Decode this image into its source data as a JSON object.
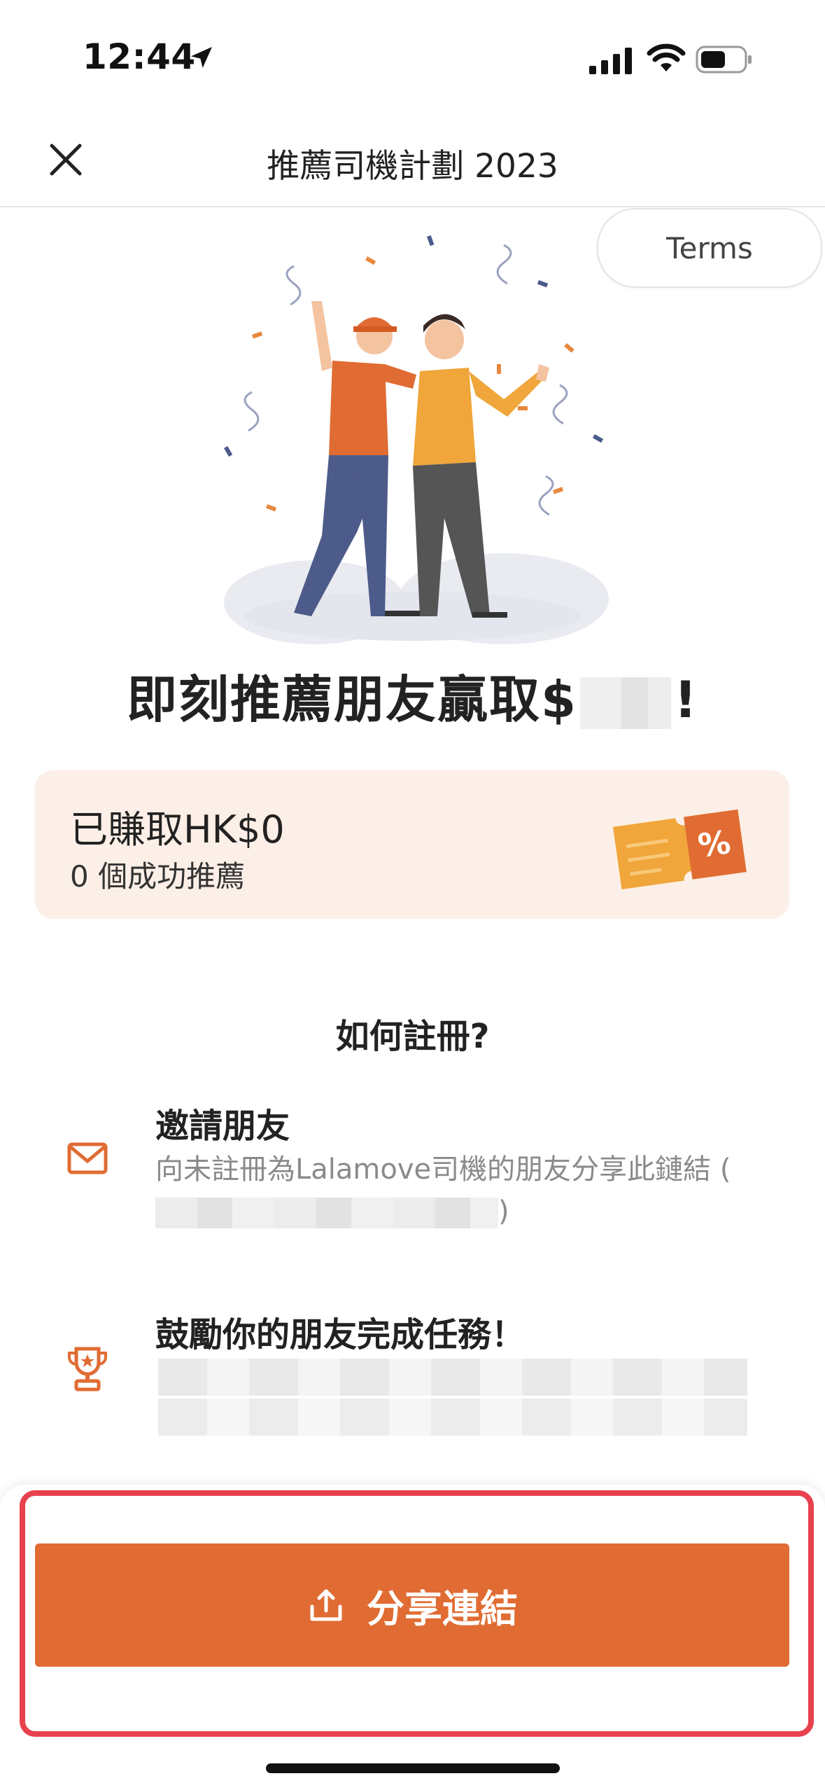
{
  "status_bar": {
    "time": "12:44"
  },
  "header": {
    "title": "推薦司機計劃 2023",
    "terms_label": "Terms"
  },
  "headline": {
    "prefix": "即刻推薦朋友贏取$",
    "suffix": "!"
  },
  "earnings": {
    "amount": "已賺取HK$0",
    "count": "0 個成功推薦"
  },
  "how_to": {
    "title": "如何註冊?",
    "steps": [
      {
        "title": "邀請朋友",
        "desc": "向未註冊為Lalamove司機的朋友分享此鏈結 (",
        "desc_end": ")"
      },
      {
        "title": "鼓勵你的朋友完成任務！"
      }
    ]
  },
  "share": {
    "label": "分享連結"
  },
  "colors": {
    "brand_orange": "#e06c33",
    "card_bg": "#fcefe7",
    "highlight_red": "#e8414e"
  }
}
